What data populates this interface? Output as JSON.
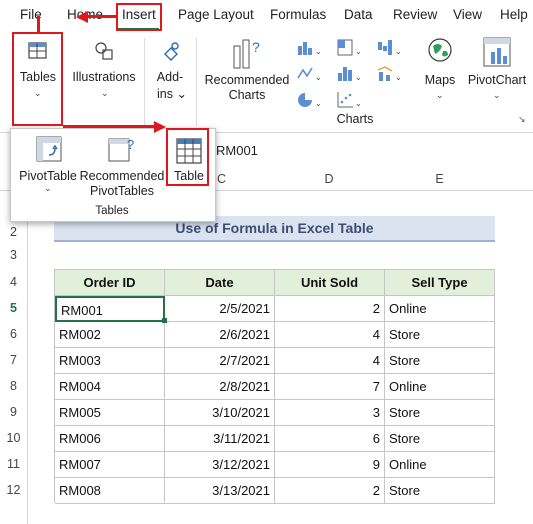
{
  "menu": {
    "items": [
      "File",
      "Home",
      "Insert",
      "Page Layout",
      "Formulas",
      "Data",
      "Review",
      "View",
      "Help"
    ]
  },
  "ribbon": {
    "tables_label": "Tables",
    "illustrations_label": "Illustrations",
    "addins_label": "Add-ins",
    "recommended_charts_label": "Recommended Charts",
    "maps_label": "Maps",
    "pivotchart_label": "PivotChart",
    "charts_group_label": "Charts"
  },
  "dropdown": {
    "pivottable_label": "PivotTable",
    "recommended_pivottables_label": "Recommended PivotTables",
    "table_label": "Table",
    "group_label": "Tables"
  },
  "formula_bar": {
    "value": "RM001"
  },
  "columns": [
    "C",
    "D",
    "E"
  ],
  "rows": [
    "2",
    "3",
    "4",
    "5",
    "6",
    "7",
    "8",
    "9",
    "10",
    "11",
    "12"
  ],
  "sheet": {
    "title": "Use of Formula in Excel Table",
    "headers": [
      "Order ID",
      "Date",
      "Unit Sold",
      "Sell Type"
    ],
    "records": [
      [
        "RM001",
        "2/5/2021",
        "2",
        "Online"
      ],
      [
        "RM002",
        "2/6/2021",
        "4",
        "Store"
      ],
      [
        "RM003",
        "2/7/2021",
        "4",
        "Store"
      ],
      [
        "RM004",
        "2/8/2021",
        "7",
        "Online"
      ],
      [
        "RM005",
        "3/10/2021",
        "3",
        "Store"
      ],
      [
        "RM006",
        "3/11/2021",
        "6",
        "Store"
      ],
      [
        "RM007",
        "3/12/2021",
        "9",
        "Online"
      ],
      [
        "RM008",
        "3/13/2021",
        "2",
        "Store"
      ]
    ]
  },
  "colors": {
    "highlight": "#e0181e",
    "header_fill": "#e2efda",
    "title_fill": "#dbe3f1"
  }
}
